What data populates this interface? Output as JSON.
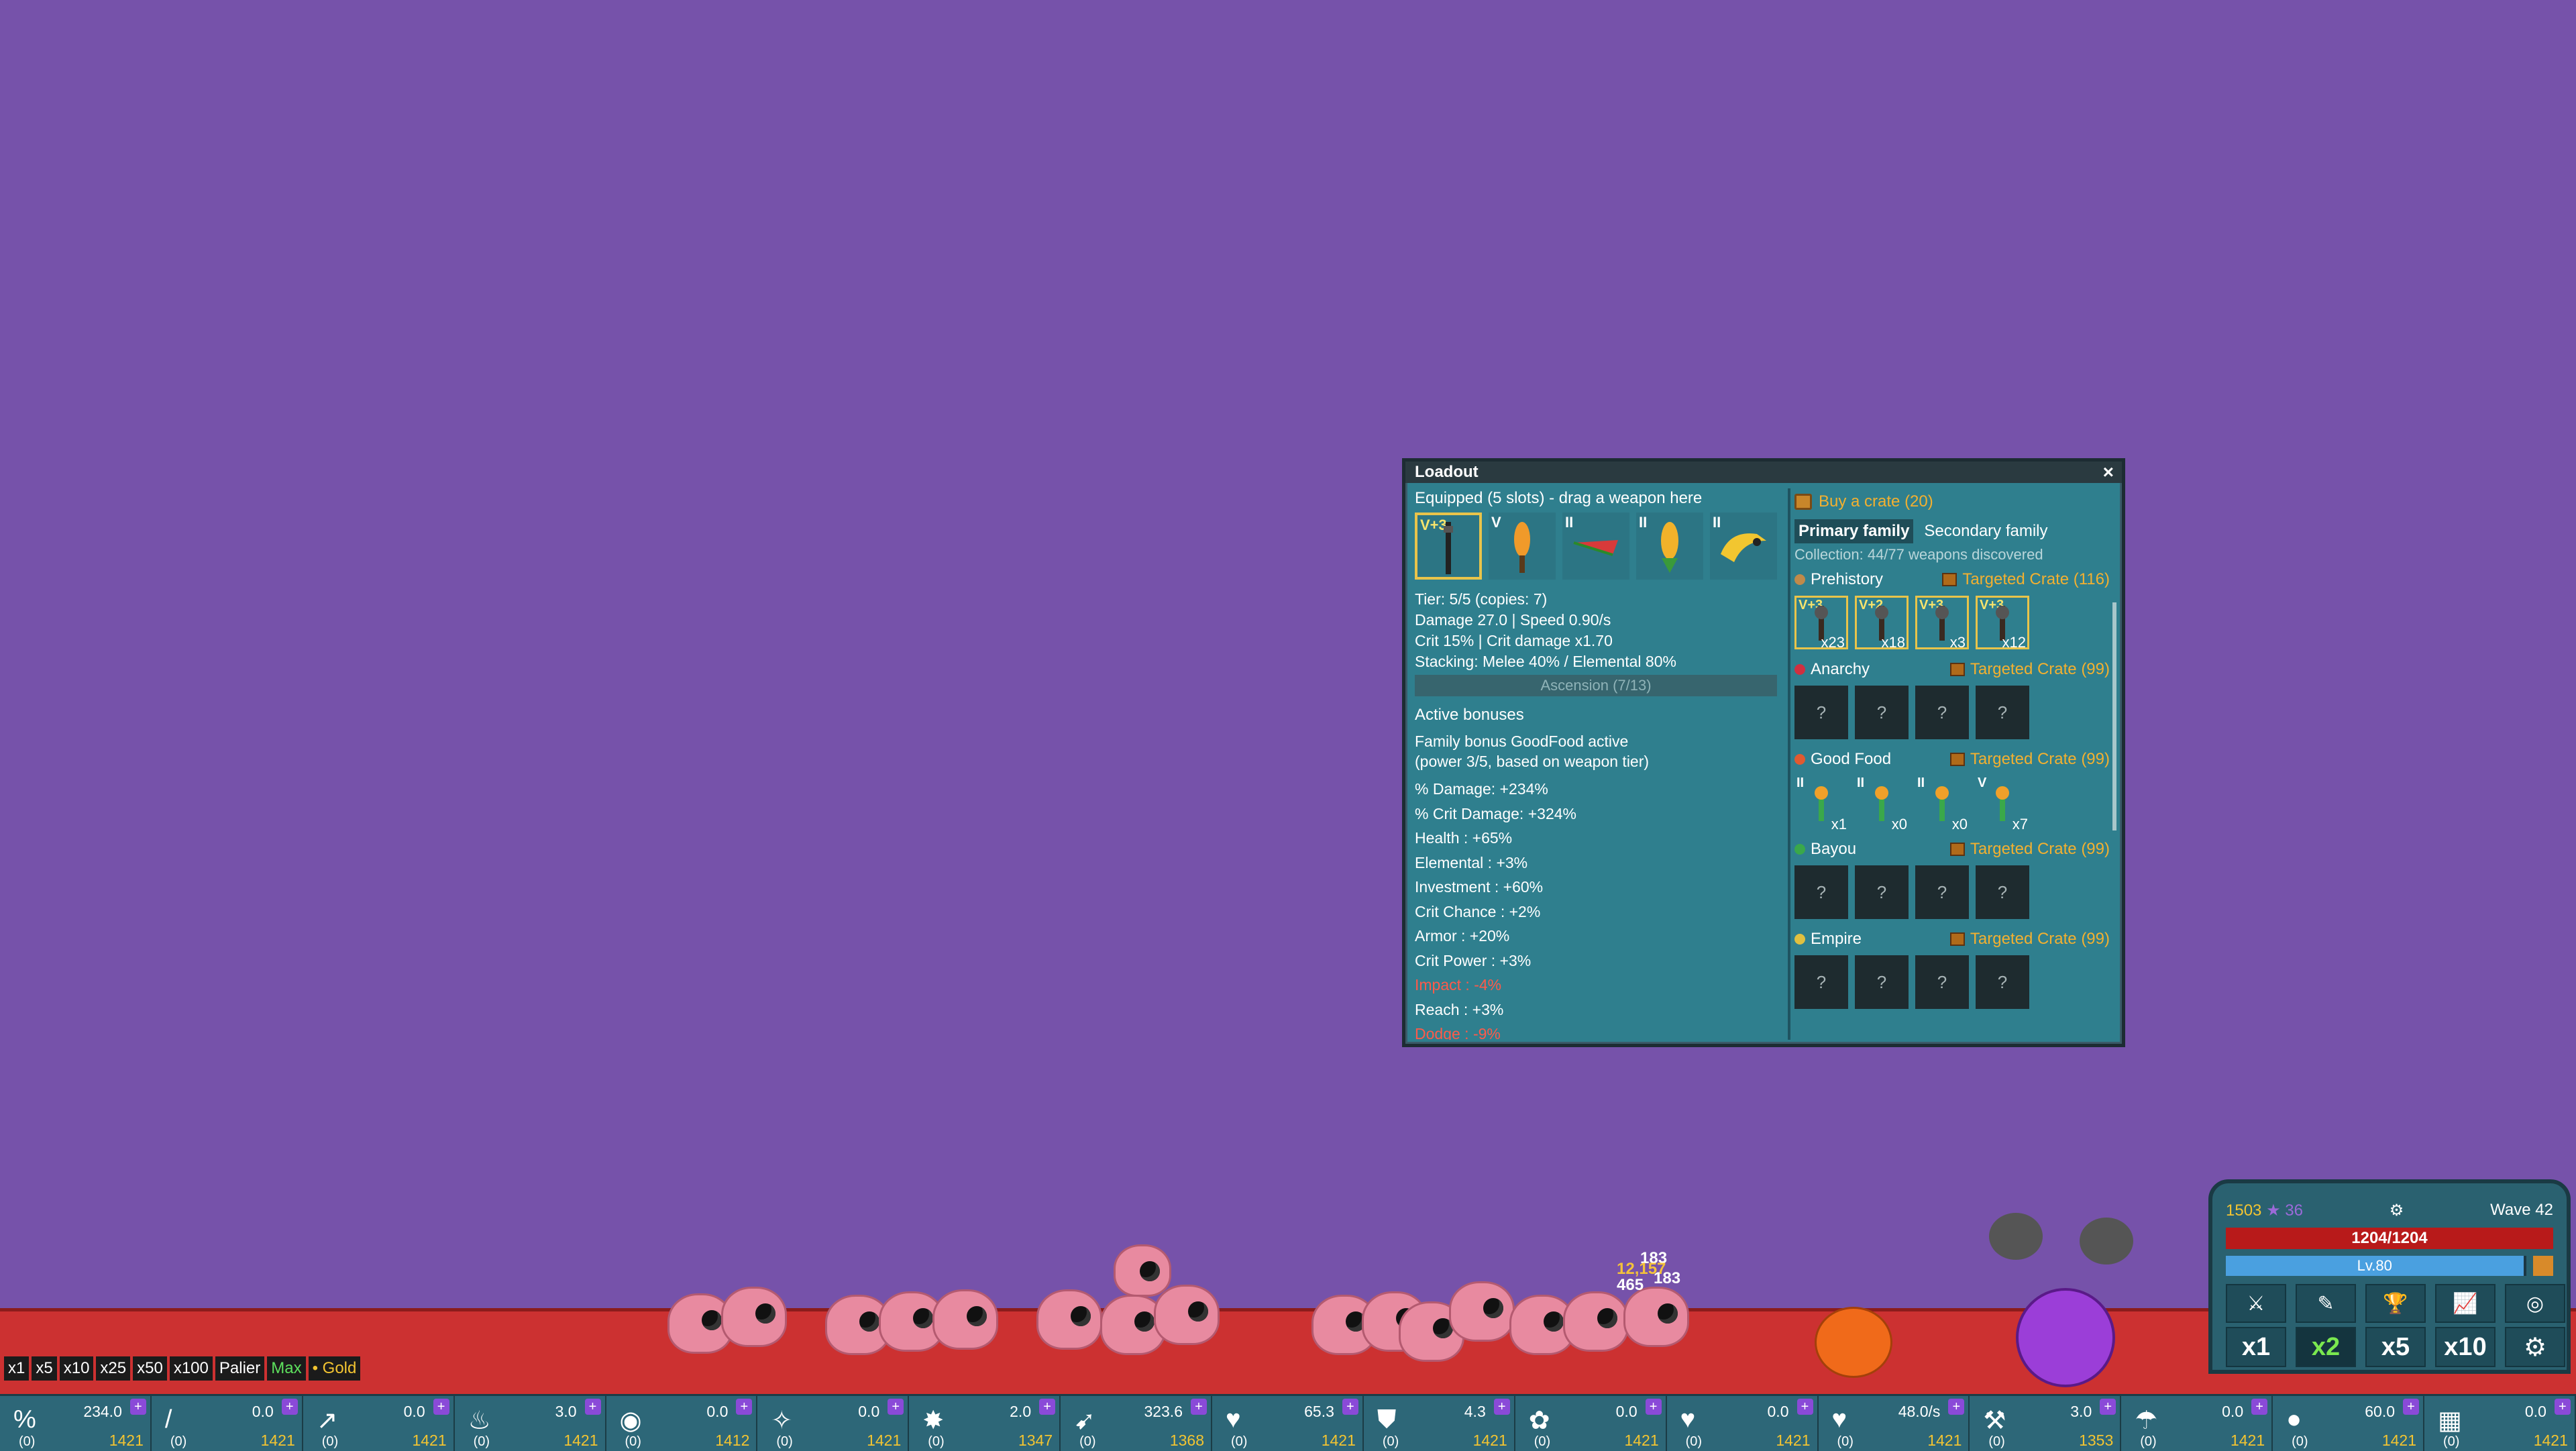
{
  "loadout": {
    "title": "Loadout",
    "close": "×",
    "equipped_label": "Equipped (5 slots) - drag a weapon here",
    "slots": [
      {
        "tier": "V+3"
      },
      {
        "tier": "V"
      },
      {
        "tier": "II"
      },
      {
        "tier": "II"
      },
      {
        "tier": "II"
      }
    ],
    "stats": [
      "Tier: 5/5 (copies: 7)",
      "Damage 27.0  |  Speed 0.90/s",
      "Crit 15%  |  Crit damage x1.70",
      "Stacking: Melee 40% / Elemental 80%"
    ],
    "ascension": "Ascension (7/13)",
    "active_bonuses_title": "Active bonuses",
    "family_bonus": "Family bonus GoodFood active",
    "family_bonus_sub": "(power 3/5, based on weapon tier)",
    "bonuses": [
      "% Damage: +234%",
      "% Crit Damage: +324%",
      "Health : +65%",
      "Elemental : +3%",
      "Investment : +60%",
      "Crit Chance : +2%",
      "Armor : +20%",
      "Crit Power : +3%",
      "Impact : -4%",
      "Reach : +3%",
      "Dodge : -9%"
    ],
    "buy_crate": "Buy a crate (20)",
    "tabs": [
      "Primary family",
      "Secondary family"
    ],
    "collection": "Collection: 44/77 weapons discovered",
    "families": [
      {
        "name": "Prehistory",
        "crate": "Targeted Crate (116)",
        "color": "#c08a4a",
        "weapons": [
          {
            "tier": "V+3",
            "count": "x23"
          },
          {
            "tier": "V+2",
            "count": "x18"
          },
          {
            "tier": "V+3",
            "count": "x3"
          },
          {
            "tier": "V+3",
            "count": "x12"
          }
        ]
      },
      {
        "name": "Anarchy",
        "crate": "Targeted Crate (99)",
        "color": "#d03040",
        "weapons": [
          {
            "unk": "?"
          },
          {
            "unk": "?"
          },
          {
            "unk": "?"
          },
          {
            "unk": "?"
          }
        ]
      },
      {
        "name": "Good Food",
        "crate": "Targeted Crate (99)",
        "color": "#e05a30",
        "weapons": [
          {
            "tier": "II",
            "count": "x1"
          },
          {
            "tier": "II",
            "count": "x0"
          },
          {
            "tier": "II",
            "count": "x0"
          },
          {
            "tier": "V",
            "count": "x7"
          }
        ]
      },
      {
        "name": "Bayou",
        "crate": "Targeted Crate (99)",
        "color": "#3aa84a",
        "weapons": [
          {
            "unk": "?"
          },
          {
            "unk": "?"
          },
          {
            "unk": "?"
          },
          {
            "unk": "?"
          }
        ]
      },
      {
        "name": "Empire",
        "crate": "Targeted Crate (99)",
        "color": "#e0c040",
        "weapons": [
          {
            "unk": "?"
          },
          {
            "unk": "?"
          },
          {
            "unk": "?"
          },
          {
            "unk": "?"
          }
        ]
      }
    ]
  },
  "speed_buttons": [
    "x1",
    "x5",
    "x10",
    "x25",
    "x50",
    "x100",
    "Palier",
    "Max",
    "• Gold"
  ],
  "damage_numbers": [
    "183",
    "12,157",
    "465",
    "183"
  ],
  "hud": {
    "gold": "1503",
    "gems": "36",
    "wave": "Wave 42",
    "hp": "1204/1204",
    "level": "Lv.80",
    "level_progress": 0.99,
    "speeds": [
      "x1",
      "x2",
      "x5",
      "x10"
    ],
    "active_speed": "x2"
  },
  "upgrades": [
    {
      "icon": "%",
      "value": "234.0",
      "level": "(0)",
      "cost": "1421"
    },
    {
      "icon": "/",
      "value": "0.0",
      "level": "(0)",
      "cost": "1421"
    },
    {
      "icon": "↗",
      "value": "0.0",
      "level": "(0)",
      "cost": "1421"
    },
    {
      "icon": "♨",
      "value": "3.0",
      "level": "(0)",
      "cost": "1421"
    },
    {
      "icon": "◉",
      "value": "0.0",
      "level": "(0)",
      "cost": "1412"
    },
    {
      "icon": "✧",
      "value": "0.0",
      "level": "(0)",
      "cost": "1421"
    },
    {
      "icon": "✸",
      "value": "2.0",
      "level": "(0)",
      "cost": "1347"
    },
    {
      "icon": "➹",
      "value": "323.6",
      "level": "(0)",
      "cost": "1368"
    },
    {
      "icon": "♥",
      "value": "65.3",
      "level": "(0)",
      "cost": "1421"
    },
    {
      "icon": "⛊",
      "value": "4.3",
      "level": "(0)",
      "cost": "1421"
    },
    {
      "icon": "✿",
      "value": "0.0",
      "level": "(0)",
      "cost": "1421"
    },
    {
      "icon": "♥",
      "value": "0.0",
      "level": "(0)",
      "cost": "1421"
    },
    {
      "icon": "♥",
      "value": "48.0/s",
      "level": "(0)",
      "cost": "1421"
    },
    {
      "icon": "⚒",
      "value": "3.0",
      "level": "(0)",
      "cost": "1353"
    },
    {
      "icon": "☂",
      "value": "0.0",
      "level": "(0)",
      "cost": "1421"
    },
    {
      "icon": "●",
      "value": "60.0",
      "level": "(0)",
      "cost": "1421"
    },
    {
      "icon": "▦",
      "value": "0.0",
      "level": "(0)",
      "cost": "1421"
    }
  ]
}
